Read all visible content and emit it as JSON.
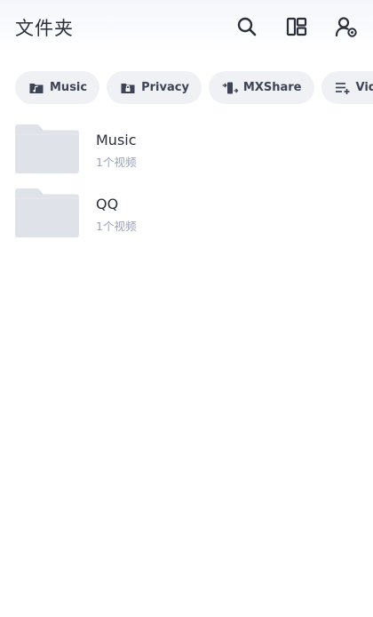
{
  "header": {
    "title": "文件夹",
    "icons": [
      "search-icon",
      "layout-icon",
      "user-settings-icon"
    ]
  },
  "chips": [
    {
      "icon": "music-folder-icon",
      "label": "Music"
    },
    {
      "icon": "privacy-lock-icon",
      "label": "Privacy"
    },
    {
      "icon": "mxshare-transfer-icon",
      "label": "MXShare"
    },
    {
      "icon": "playlist-add-icon",
      "label": "Video P"
    }
  ],
  "folders": [
    {
      "name": "Music",
      "count": "1个视频"
    },
    {
      "name": "QQ",
      "count": "1个视频"
    }
  ],
  "colors": {
    "chip_background": "#eff1f5",
    "folder_thumb": "#dfe2e8",
    "text_primary": "#2b2f3b",
    "text_secondary": "#9aa2b4"
  }
}
